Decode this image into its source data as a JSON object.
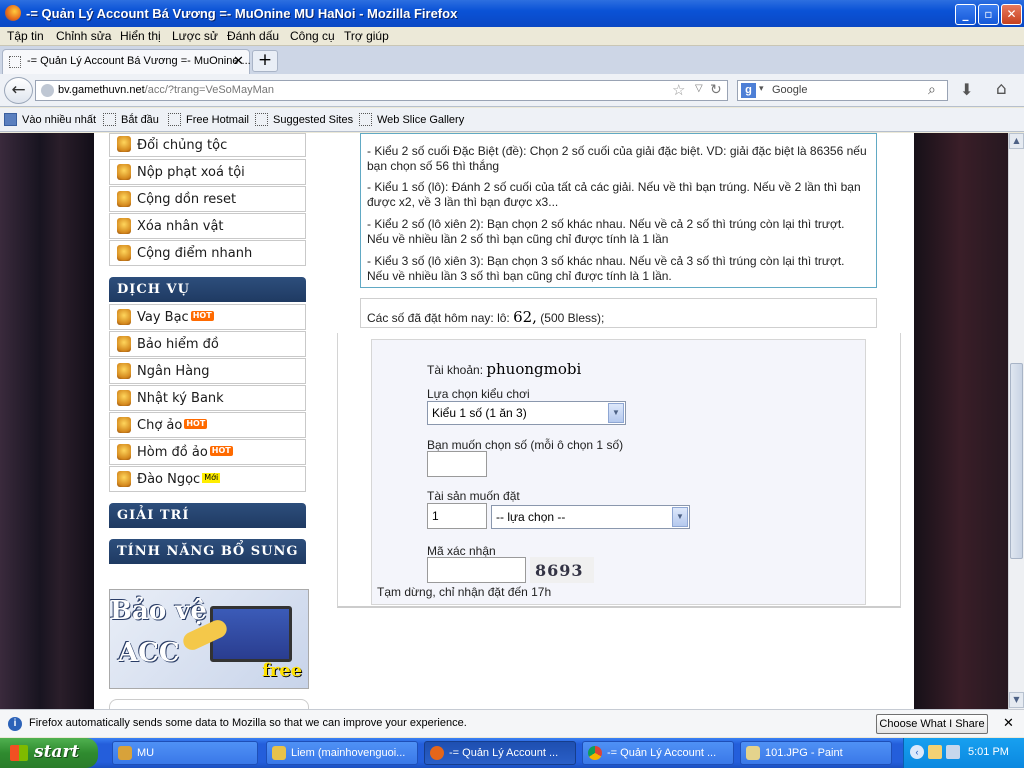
{
  "window": {
    "title": "-= Quản Lý Account Bá Vương =- MuOnine MU HaNoi - Mozilla Firefox",
    "controls": {
      "minimize": "_",
      "maximize": "▫",
      "close": "✕"
    }
  },
  "menu": [
    "Tập tin",
    "Chỉnh sửa",
    "Hiển thị",
    "Lược sử",
    "Đánh dấu",
    "Công cụ",
    "Trợ giúp"
  ],
  "tab": {
    "title": "-= Quản Lý Account Bá Vương =- MuOnine ...",
    "close": "✕",
    "new_tab": "+"
  },
  "nav": {
    "url_host": "bv.gamethuvn.net",
    "url_path": "/acc/?trang=VeSoMayMan",
    "search_engine": "g",
    "search_placeholder": "Google"
  },
  "bookmarks": [
    "Vào nhiều nhất",
    "Bắt đầu",
    "Free Hotmail",
    "Suggested Sites",
    "Web Slice Gallery"
  ],
  "sidebar": {
    "top_items": [
      "Đổi chủng tộc",
      "Nộp phạt xoá tội",
      "Cộng dồn reset",
      "Xóa nhân vật",
      "Cộng điểm nhanh"
    ],
    "services_header": "DỊCH VỤ",
    "service_items": [
      {
        "label": "Vay Bạc",
        "badge": "HOT"
      },
      {
        "label": "Bảo hiểm đồ",
        "badge": ""
      },
      {
        "label": "Ngân Hàng",
        "badge": ""
      },
      {
        "label": "Nhật ký Bank",
        "badge": ""
      },
      {
        "label": "Chợ ảo",
        "badge": "HOT"
      },
      {
        "label": "Hòm đồ ảo",
        "badge": "HOT"
      },
      {
        "label": "Đào Ngọc",
        "badge": "Mới"
      }
    ],
    "entertainment_header": "GIẢI TRÍ",
    "extras_header": "TÍNH NĂNG BỔ SUNG",
    "banner": {
      "line1": "Bảo vệ",
      "line2": "ACC",
      "free": "free"
    }
  },
  "rules": [
    "- Kiểu 2 số cuối Đặc Biệt (đề): Chọn 2 số cuối của giải đặc biệt. VD: giải đặc biệt là 86356 nếu bạn chọn số 56 thì thắng",
    "- Kiểu 1 số (lô): Đánh 2 số cuối của tất cả các giải. Nếu về thì bạn trúng. Nếu về 2 lần thì bạn được x2, về 3 lần thì bạn được x3...",
    "- Kiểu 2 số (lô xiên 2): Bạn chọn 2 số khác nhau. Nếu về cả 2 số thì trúng còn lại thì trượt. Nếu về nhiều lần 2 số thì bạn cũng chỉ được tính là 1 lần",
    "- Kiểu 3 số (lô xiên 3): Bạn chọn 3 số khác nhau. Nếu về cả 3 số thì trúng còn lại thì trượt. Nếu về nhiều lần 3 số thì bạn cũng chỉ được tính là 1 lần."
  ],
  "placed": {
    "prefix": "Các số đã đặt hôm nay: lô:",
    "numbers": "62,",
    "suffix": "(500 Bless);"
  },
  "form": {
    "account_label": "Tài khoản:",
    "account_value": "phuongmobi",
    "game_type_label": "Lựa chọn kiểu chơi",
    "game_type_value": "Kiểu 1 số (1 ăn 3)",
    "number_label": "Bạn muốn chọn số (mỗi ô chọn 1 số)",
    "number_value": "",
    "asset_label": "Tài sản muốn đặt",
    "asset_amount": "1",
    "asset_type": "-- lựa chọn --",
    "captcha_label": "Mã xác nhận",
    "captcha_value": "",
    "captcha_image_text": "8693",
    "notice": "Tạm dừng, chỉ nhận đặt đến 17h"
  },
  "notification": {
    "text": "Firefox automatically sends some data to Mozilla so that we can improve your experience.",
    "button": "Choose What I Share",
    "close": "✕"
  },
  "taskbar": {
    "start": "start",
    "tasks": [
      {
        "label": "MU",
        "active": false
      },
      {
        "label": "Liem (mainhovenguoi...",
        "active": false
      },
      {
        "label": "-= Quản Lý Account ...",
        "active": true
      },
      {
        "label": "-= Quản Lý Account ...",
        "active": false
      },
      {
        "label": "101.JPG - Paint",
        "active": false
      }
    ],
    "clock": "5:01 PM"
  }
}
